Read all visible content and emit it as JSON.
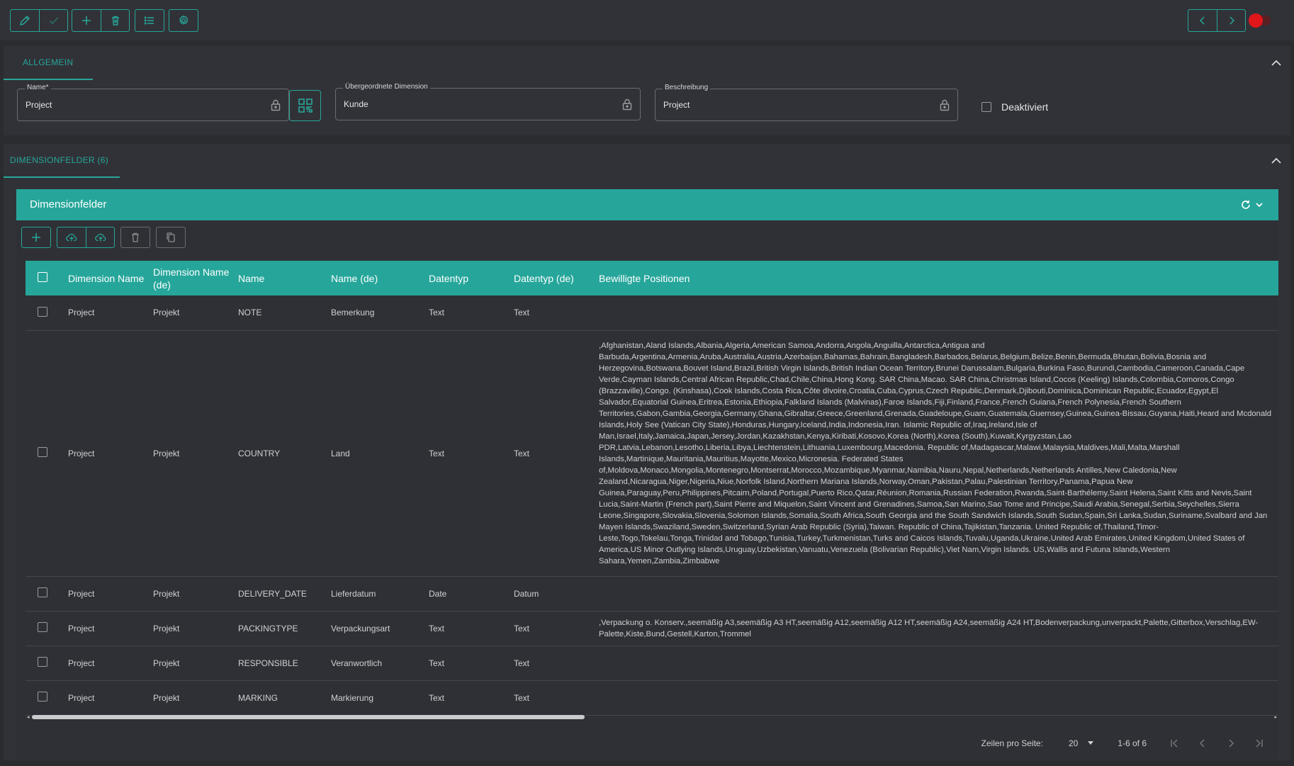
{
  "toolbar": {
    "buttons": [
      "edit-icon",
      "check-icon",
      "add-icon",
      "delete-icon",
      "list-icon",
      "settings-icon"
    ],
    "nav_prev": "chevron-left-icon",
    "nav_next": "chevron-right-icon"
  },
  "general": {
    "tab_label": "ALLGEMEIN",
    "name_label": "Name*",
    "name_value": "Project",
    "parent_label": "Übergeordnete Dimension",
    "parent_value": "Kunde",
    "description_label": "Beschreibung",
    "description_value": "Project",
    "deactivated_label": "Deaktiviert"
  },
  "dimfields": {
    "tab_label": "DIMENSIONFELDER (6)",
    "header_title": "Dimensionfelder",
    "columns": [
      "Dimension Name",
      "Dimension Name (de)",
      "Name",
      "Name (de)",
      "Datentyp",
      "Datentyp (de)",
      "Bewilligte Positionen"
    ],
    "rows": [
      {
        "dim": "Project",
        "dim_de": "Projekt",
        "name": "NOTE",
        "name_de": "Bemerkung",
        "type": "Text",
        "type_de": "Text",
        "allowed": ""
      },
      {
        "dim": "Project",
        "dim_de": "Projekt",
        "name": "COUNTRY",
        "name_de": "Land",
        "type": "Text",
        "type_de": "Text",
        "allowed": ",Afghanistan,Aland Islands,Albania,Algeria,American Samoa,Andorra,Angola,Anguilla,Antarctica,Antigua and Barbuda,Argentina,Armenia,Aruba,Australia,Austria,Azerbaijan,Bahamas,Bahrain,Bangladesh,Barbados,Belarus,Belgium,Belize,Benin,Bermuda,Bhutan,Bolivia,Bosnia and Herzegovina,Botswana,Bouvet Island,Brazil,British Virgin Islands,British Indian Ocean Territory,Brunei Darussalam,Bulgaria,Burkina Faso,Burundi,Cambodia,Cameroon,Canada,Cape Verde,Cayman Islands,Central African Republic,Chad,Chile,China,Hong Kong. SAR China,Macao. SAR China,Christmas Island,Cocos (Keeling) Islands,Colombia,Comoros,Congo (Brazzaville),Congo. (Kinshasa),Cook Islands,Costa Rica,Côte dIvoire,Croatia,Cuba,Cyprus,Czech Republic,Denmark,Djibouti,Dominica,Dominican Republic,Ecuador,Egypt,El Salvador,Equatorial Guinea,Eritrea,Estonia,Ethiopia,Falkland Islands (Malvinas),Faroe Islands,Fiji,Finland,France,French Guiana,French Polynesia,French Southern Territories,Gabon,Gambia,Georgia,Germany,Ghana,Gibraltar,Greece,Greenland,Grenada,Guadeloupe,Guam,Guatemala,Guernsey,Guinea,Guinea-Bissau,Guyana,Haiti,Heard and Mcdonald Islands,Holy See (Vatican City State),Honduras,Hungary,Iceland,India,Indonesia,Iran. Islamic Republic of,Iraq,Ireland,Isle of Man,Israel,Italy,Jamaica,Japan,Jersey,Jordan,Kazakhstan,Kenya,Kiribati,Kosovo,Korea (North),Korea (South),Kuwait,Kyrgyzstan,Lao PDR,Latvia,Lebanon,Lesotho,Liberia,Libya,Liechtenstein,Lithuania,Luxembourg,Macedonia. Republic of,Madagascar,Malawi,Malaysia,Maldives,Mali,Malta,Marshall Islands,Martinique,Mauritania,Mauritius,Mayotte,Mexico,Micronesia. Federated States of,Moldova,Monaco,Mongolia,Montenegro,Montserrat,Morocco,Mozambique,Myanmar,Namibia,Nauru,Nepal,Netherlands,Netherlands Antilles,New Caledonia,New Zealand,Nicaragua,Niger,Nigeria,Niue,Norfolk Island,Northern Mariana Islands,Norway,Oman,Pakistan,Palau,Palestinian Territory,Panama,Papua New Guinea,Paraguay,Peru,Philippines,Pitcairn,Poland,Portugal,Puerto Rico,Qatar,Réunion,Romania,Russian Federation,Rwanda,Saint-Barthélemy,Saint Helena,Saint Kitts and Nevis,Saint Lucia,Saint-Martin (French part),Saint Pierre and Miquelon,Saint Vincent and Grenadines,Samoa,San Marino,Sao Tome and Principe,Saudi Arabia,Senegal,Serbia,Seychelles,Sierra Leone,Singapore,Slovakia,Slovenia,Solomon Islands,Somalia,South Africa,South Georgia and the South Sandwich Islands,South Sudan,Spain,Sri Lanka,Sudan,Suriname,Svalbard and Jan Mayen Islands,Swaziland,Sweden,Switzerland,Syrian Arab Republic (Syria),Taiwan. Republic of China,Tajikistan,Tanzania. United Republic of,Thailand,Timor-Leste,Togo,Tokelau,Tonga,Trinidad and Tobago,Tunisia,Turkey,Turkmenistan,Turks and Caicos Islands,Tuvalu,Uganda,Ukraine,United Arab Emirates,United Kingdom,United States of America,US Minor Outlying Islands,Uruguay,Uzbekistan,Vanuatu,Venezuela (Bolivarian Republic),Viet Nam,Virgin Islands. US,Wallis and Futuna Islands,Western Sahara,Yemen,Zambia,Zimbabwe"
      },
      {
        "dim": "Project",
        "dim_de": "Projekt",
        "name": "DELIVERY_DATE",
        "name_de": "Lieferdatum",
        "type": "Date",
        "type_de": "Datum",
        "allowed": ""
      },
      {
        "dim": "Project",
        "dim_de": "Projekt",
        "name": "PACKINGTYPE",
        "name_de": "Verpackungsart",
        "type": "Text",
        "type_de": "Text",
        "allowed": ",Verpackung o. Konserv.,seemäßig A3,seemäßig A3 HT,seemäßig A12,seemäßig A12 HT,seemäßig A24,seemäßig A24 HT,Bodenverpackung,unverpackt,Palette,Gitterbox,Verschlag,EW-Palette,Kiste,Bund,Gestell,Karton,Trommel"
      },
      {
        "dim": "Project",
        "dim_de": "Projekt",
        "name": "RESPONSIBLE",
        "name_de": "Veranwortlich",
        "type": "Text",
        "type_de": "Text",
        "allowed": ""
      },
      {
        "dim": "Project",
        "dim_de": "Projekt",
        "name": "MARKING",
        "name_de": "Markierung",
        "type": "Text",
        "type_de": "Text",
        "allowed": ""
      }
    ]
  },
  "pager": {
    "rows_label": "Zeilen pro Seite:",
    "rows_value": "20",
    "range": "1-6 of 6"
  },
  "colors": {
    "accent": "#26a69a",
    "background": "#2b2c30",
    "panel": "#313237",
    "toggle": "#e0161b"
  }
}
